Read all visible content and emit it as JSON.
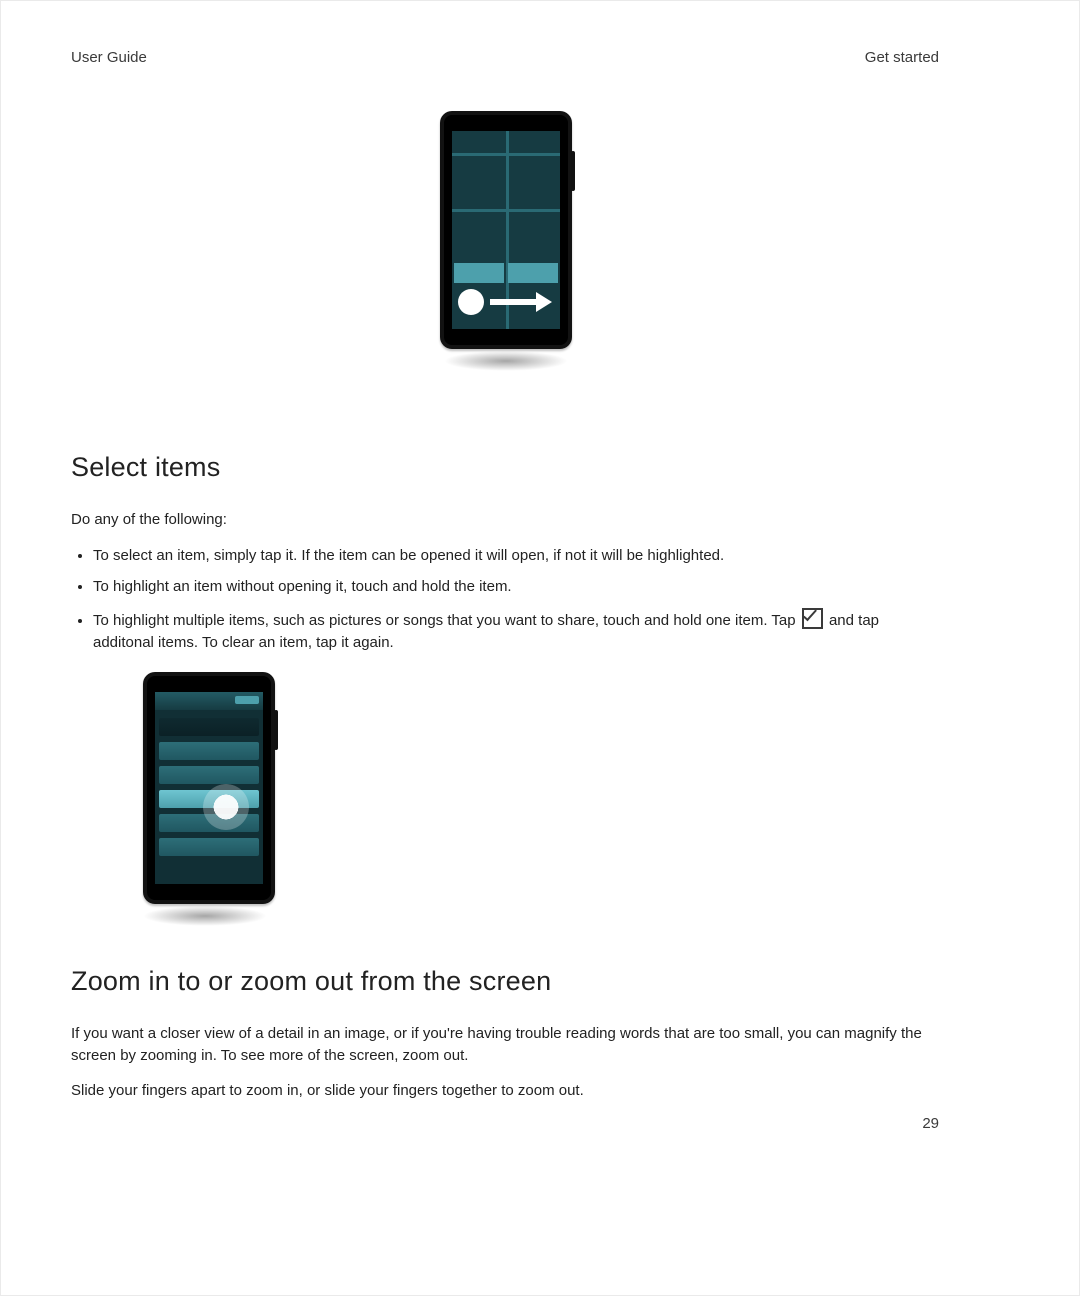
{
  "header": {
    "left": "User Guide",
    "right": "Get started"
  },
  "page_number": "29",
  "section_select": {
    "title": "Select items",
    "intro": "Do any of the following:",
    "bullets": {
      "b1": "To select an item, simply tap it. If the item can be opened it will open, if not it will be highlighted.",
      "b2": "To highlight an item without opening it, touch and hold the item.",
      "b3_pre": "To highlight multiple items, such as pictures or songs that you want to share, touch and hold one item. Tap ",
      "b3_post": " and tap additonal items. To clear an item, tap it again."
    }
  },
  "section_zoom": {
    "title": "Zoom in to or zoom out from the screen",
    "p1": "If you want a closer view of a detail in an image, or if you're having trouble reading words that are too small, you can magnify the screen by zooming in. To see more of the screen, zoom out.",
    "p2": "Slide your fingers apart to zoom in, or slide your fingers together to zoom out."
  }
}
